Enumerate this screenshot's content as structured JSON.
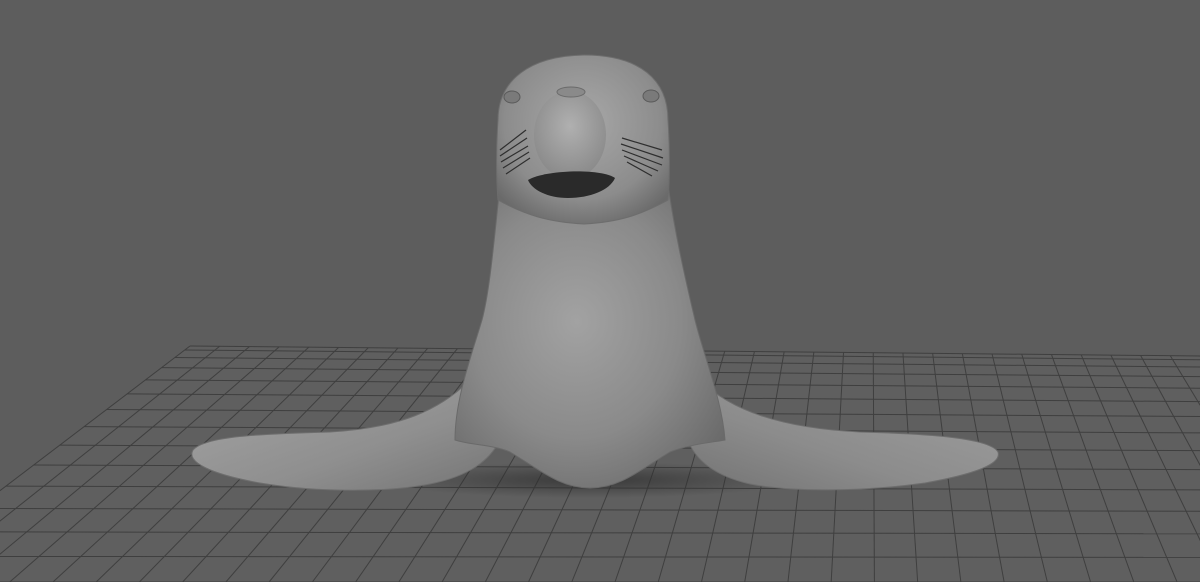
{
  "viewport": {
    "background_color": "#5d5d5d",
    "grid_color": "#3f3f3f",
    "grid_fill_color": "#5f5f5f",
    "model_color": "#8e8e8e",
    "whisker_color": "#2e2e2e"
  },
  "scene": {
    "model": "seal",
    "view": "perspective",
    "shading": "smooth-shaded",
    "ground_grid_visible": true
  }
}
